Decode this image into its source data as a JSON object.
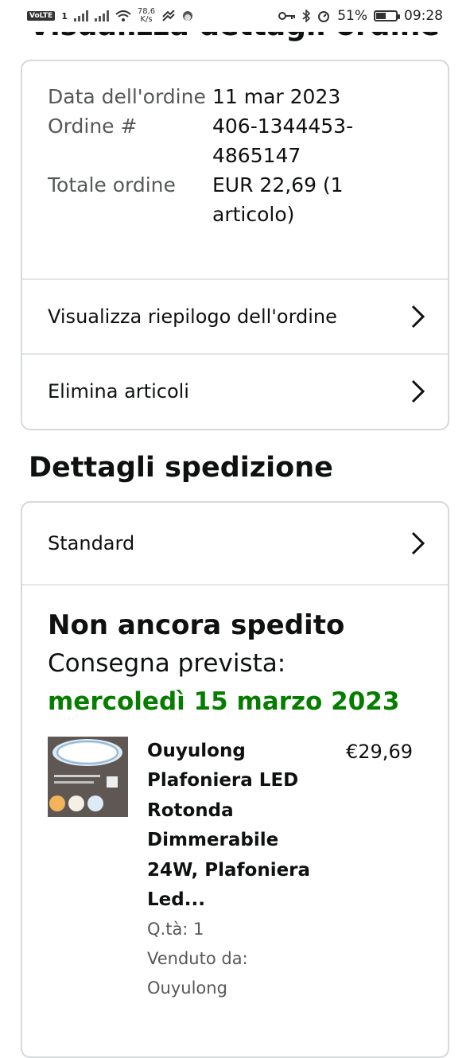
{
  "status_bar": {
    "left_badge": "VoLTE",
    "left_badge_sub": "1",
    "speed": "78,6",
    "speed_unit": "K/s",
    "battery_pct": "51%",
    "battery_fraction": 0.51,
    "time": "09:28"
  },
  "page": {
    "cut_title": "Visualizza dettagli ordine"
  },
  "order": {
    "date_label": "Data dell'ordine",
    "date_value": "11 mar 2023",
    "number_label": "Ordine #",
    "number_value": "406-1344453-4865147",
    "total_label": "Totale ordine",
    "total_value": "EUR 22,69 (1 articolo)",
    "summary_link": "Visualizza riepilogo dell'ordine",
    "delete_link": "Elimina articoli"
  },
  "shipping": {
    "section_title": "Dettagli spedizione",
    "method": "Standard",
    "status": "Non ancora spedito",
    "delivery_label": "Consegna prevista:",
    "delivery_date": "mercoledì 15 marzo 2023"
  },
  "item": {
    "title": "Ouyulong Plafoniera LED Rotonda Dimmerabile 24W, Plafoniera Led...",
    "price": "€29,69",
    "qty": "Q.tà: 1",
    "seller": "Venduto da: Ouyulong"
  },
  "colors": {
    "delivery_green": "#067d00",
    "border": "#d5d9d9"
  }
}
